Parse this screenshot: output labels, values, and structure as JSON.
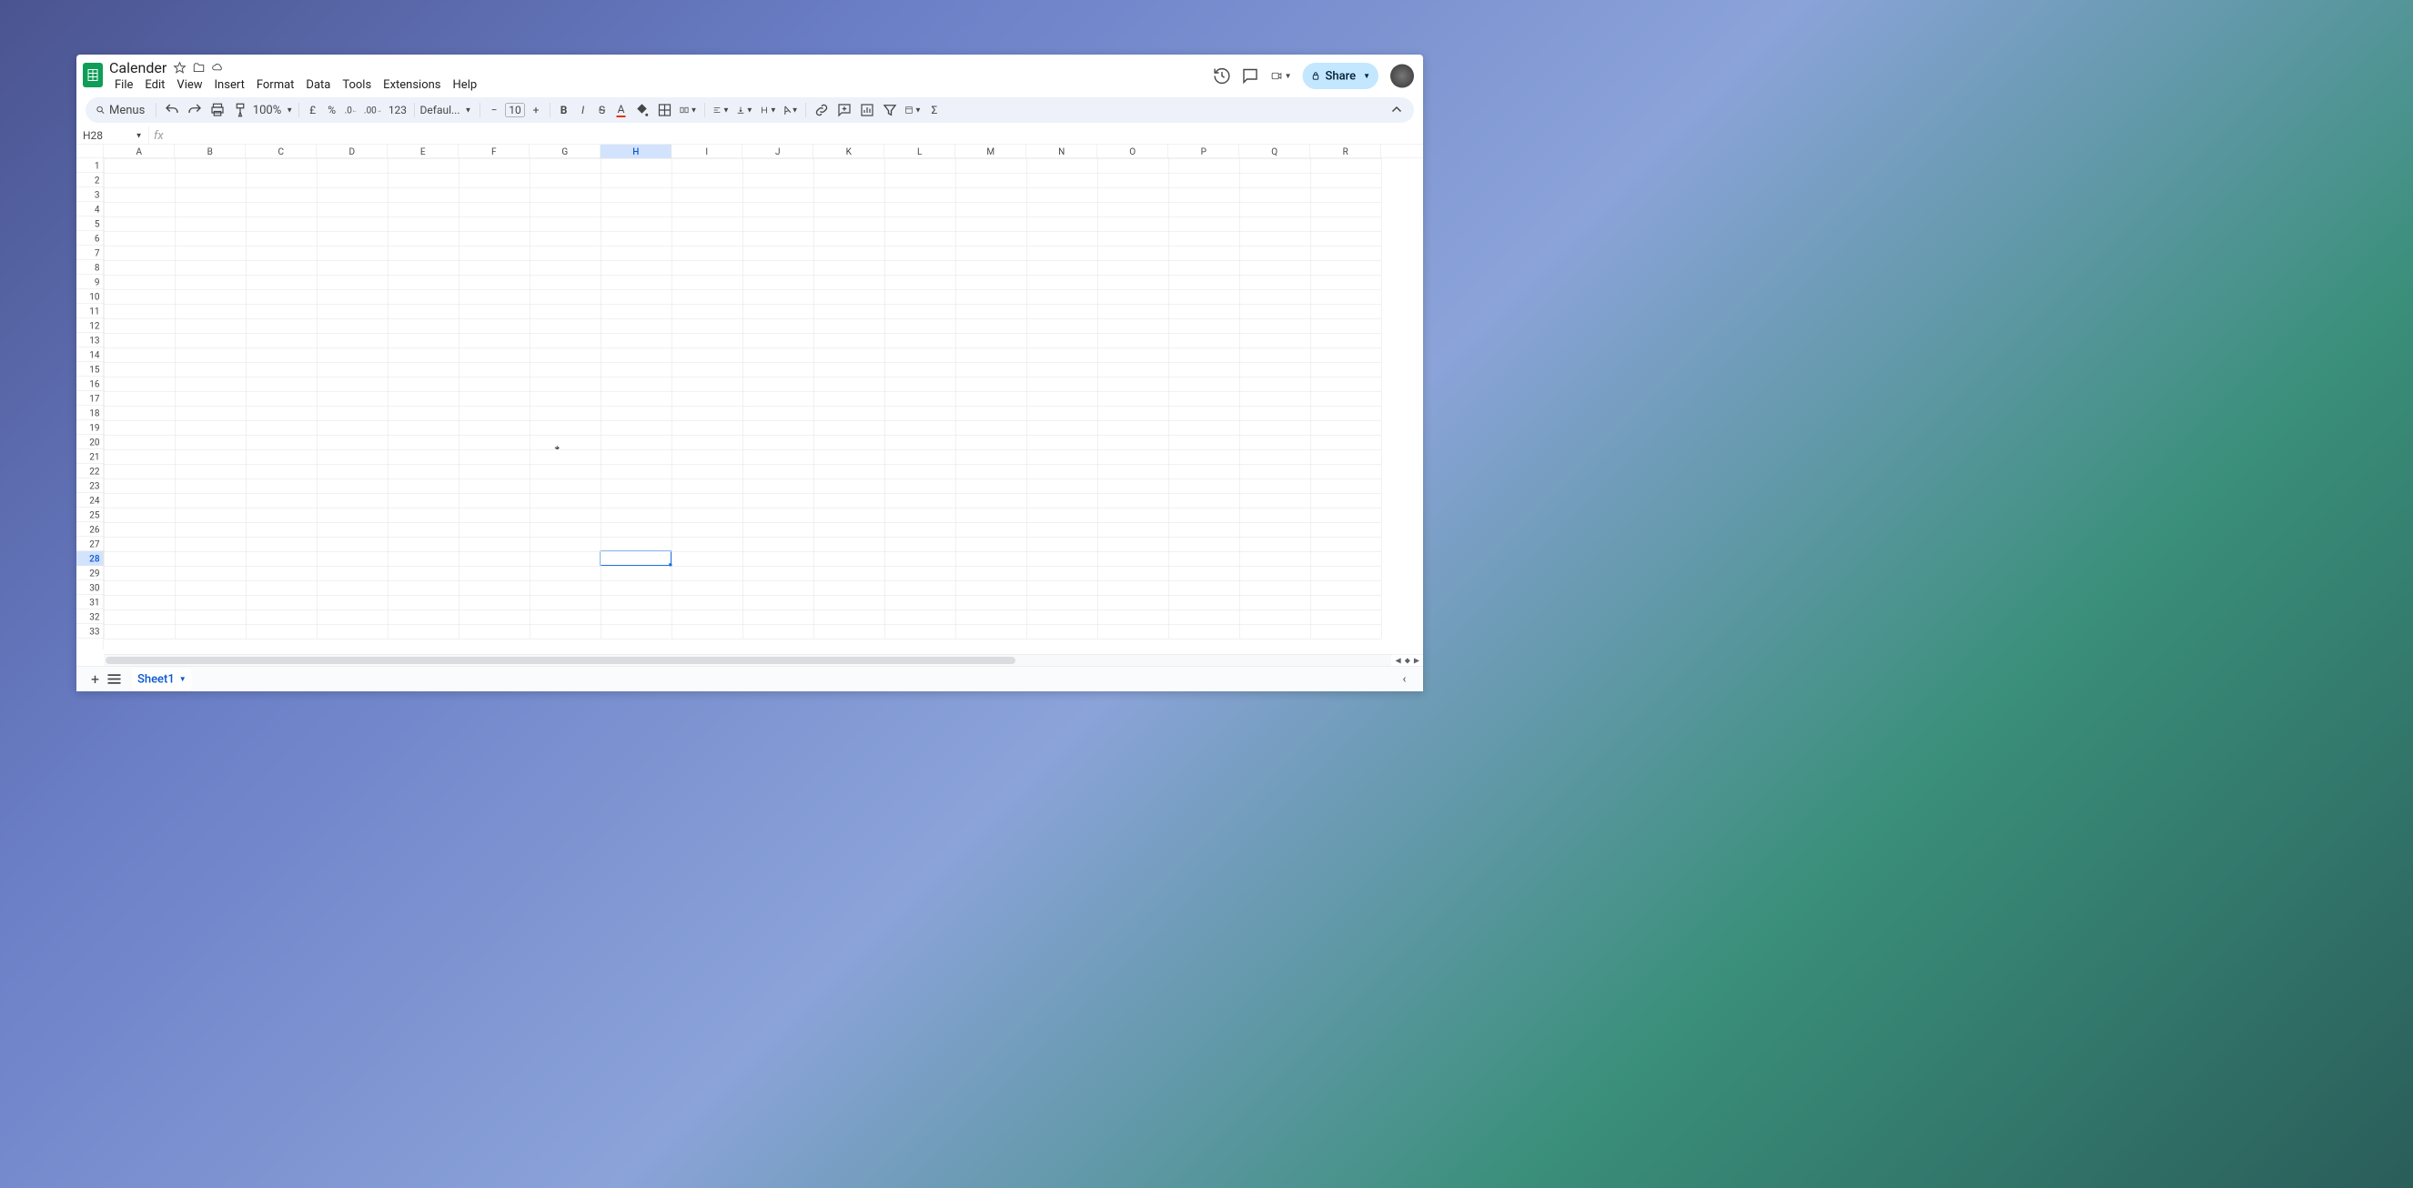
{
  "document": {
    "title": "Calender"
  },
  "menu": {
    "items": [
      "File",
      "Edit",
      "View",
      "Insert",
      "Format",
      "Data",
      "Tools",
      "Extensions",
      "Help"
    ]
  },
  "toolbar": {
    "menus_label": "Menus",
    "zoom": "100%",
    "currency_symbol": "£",
    "format_123": "123",
    "font_name": "Defaul...",
    "font_size": "10"
  },
  "share": {
    "label": "Share"
  },
  "namebox": {
    "value": "H28"
  },
  "formula_bar": {
    "value": ""
  },
  "columns": [
    "A",
    "B",
    "C",
    "D",
    "E",
    "F",
    "G",
    "H",
    "I",
    "J",
    "K",
    "L",
    "M",
    "N",
    "O",
    "P",
    "Q",
    "R"
  ],
  "rows": [
    "1",
    "2",
    "3",
    "4",
    "5",
    "6",
    "7",
    "8",
    "9",
    "10",
    "11",
    "12",
    "13",
    "14",
    "15",
    "16",
    "17",
    "18",
    "19",
    "20",
    "21",
    "22",
    "23",
    "24",
    "25",
    "26",
    "27",
    "28",
    "29",
    "30",
    "31",
    "32",
    "33"
  ],
  "selected": {
    "col_index": 7,
    "row_index": 27
  },
  "sheet_tab": {
    "name": "Sheet1"
  },
  "bordered": {
    "cols": 14,
    "rows": 17
  }
}
